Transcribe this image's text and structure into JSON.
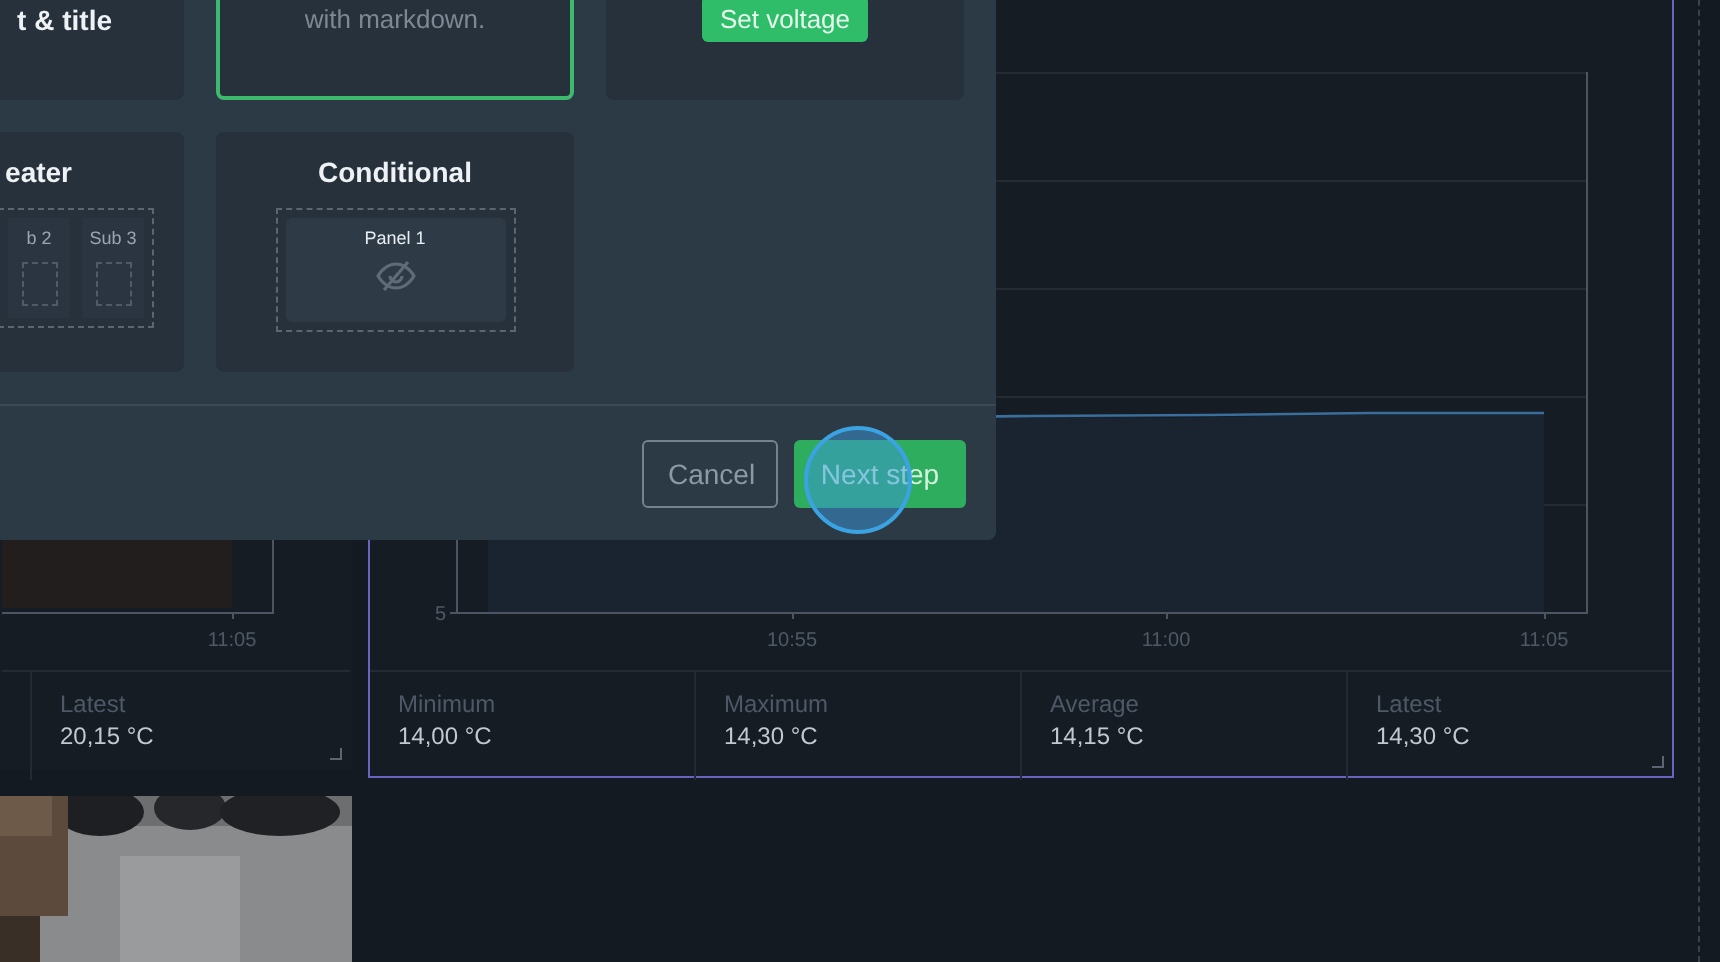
{
  "dashboard": {
    "widgets": [
      {
        "selected": false,
        "x_ticks": [
          "11:05"
        ],
        "stats": [
          {
            "label": "Latest",
            "value": "20,15 °C"
          }
        ]
      },
      {
        "selected": true,
        "y_ticks": [
          "5"
        ],
        "x_ticks": [
          "10:55",
          "11:00",
          "11:05"
        ],
        "stats": [
          {
            "label": "Minimum",
            "value": "14,00 °C"
          },
          {
            "label": "Maximum",
            "value": "14,30 °C"
          },
          {
            "label": "Average",
            "value": "14,15 °C"
          },
          {
            "label": "Latest",
            "value": "14,30 °C"
          }
        ]
      }
    ]
  },
  "modal": {
    "cards": [
      {
        "kind": "text",
        "title": "t & title",
        "selected": false
      },
      {
        "kind": "markdown",
        "text": "with markdown.",
        "selected": true
      },
      {
        "kind": "button",
        "button": "Set voltage",
        "selected": false
      },
      {
        "kind": "repeater",
        "title": "eater",
        "panels": [
          "b 2",
          "Sub 3"
        ],
        "selected": false
      },
      {
        "kind": "conditional",
        "title": "Conditional",
        "panel": "Panel 1",
        "selected": false
      }
    ],
    "buttons": [
      {
        "label": "Cancel",
        "kind": "secondary"
      },
      {
        "label": "Next step",
        "kind": "primary"
      }
    ]
  }
}
